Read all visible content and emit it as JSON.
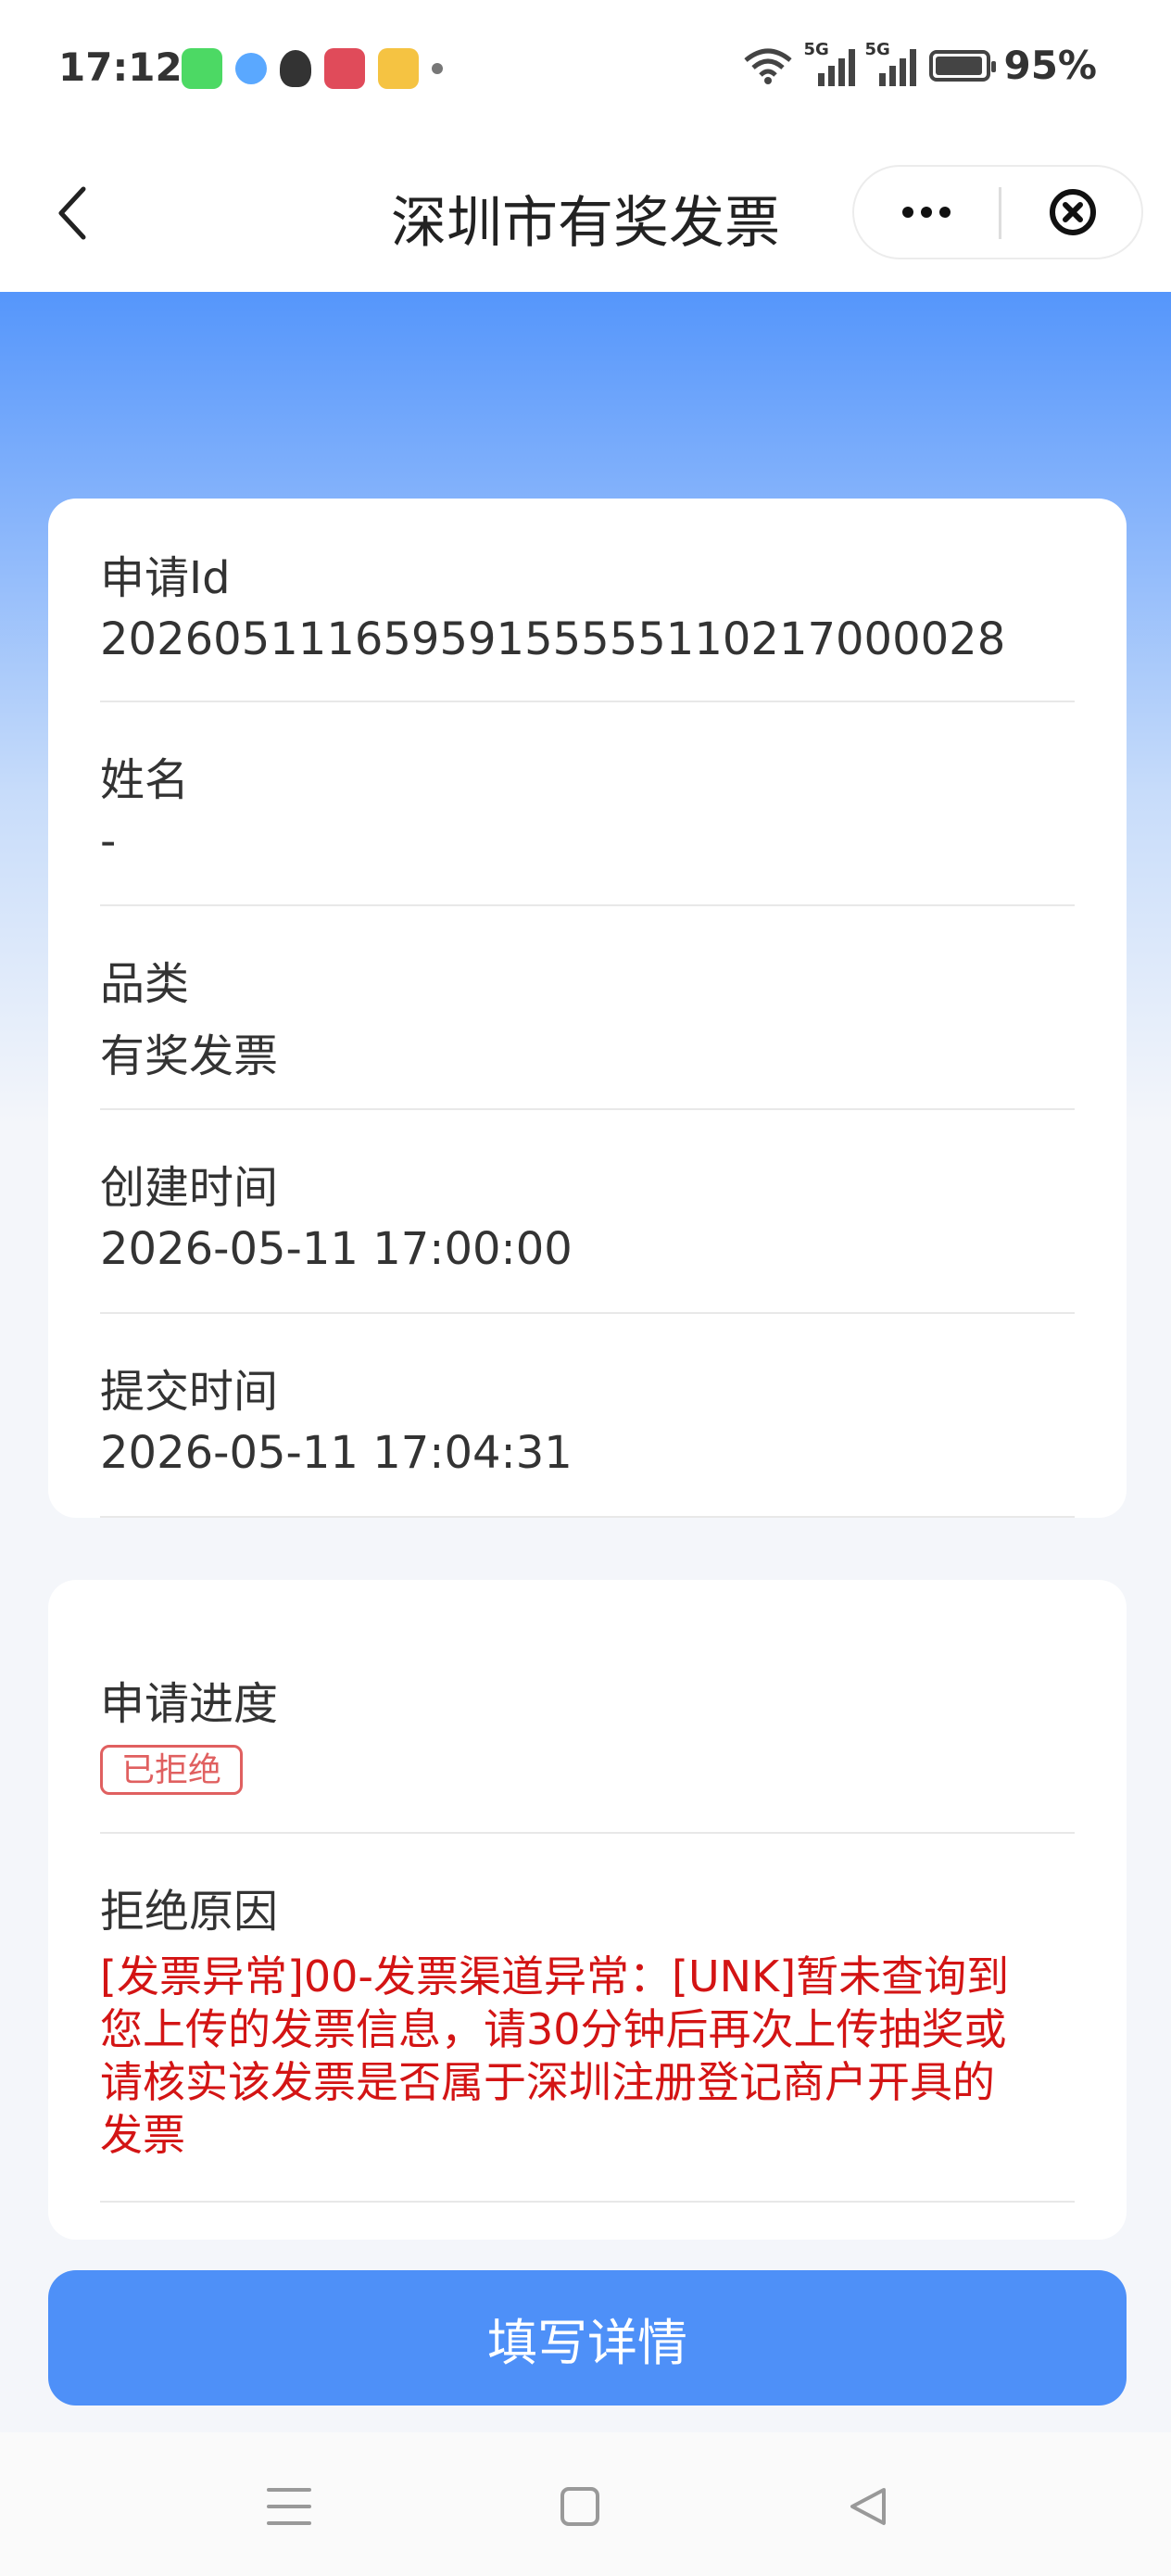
{
  "status_bar": {
    "time": "17:12",
    "notification_icons": [
      "phone-icon",
      "browser-icon",
      "qq-icon",
      "bank-icon",
      "notes-icon"
    ],
    "signal_labels": [
      "5G",
      "5G"
    ],
    "battery": "95%"
  },
  "nav": {
    "title": "深圳市有奖发票"
  },
  "info": {
    "fields": [
      {
        "label": "申请Id",
        "value": "20260511165959155555110217000028"
      },
      {
        "label": "姓名",
        "value": "-"
      },
      {
        "label": "品类",
        "value": "有奖发票"
      },
      {
        "label": "创建时间",
        "value": "2026-05-11 17:00:00"
      },
      {
        "label": "提交时间",
        "value": "2026-05-11 17:04:31"
      }
    ]
  },
  "progress": {
    "label": "申请进度",
    "status": "已拒绝",
    "reason_label": "拒绝原因",
    "reason_lines": [
      "[发票异常]00-发票渠道异常：[UNK]暂未查询到",
      "您上传的发票信息，请30分钟后再次上传抽奖或",
      "请核实该发票是否属于深圳注册登记商户开具的",
      "发票"
    ]
  },
  "actions": {
    "fill_details": "填写详情"
  },
  "colors": {
    "brand_blue": "#4e90f8",
    "reject_red": "#d31414"
  }
}
